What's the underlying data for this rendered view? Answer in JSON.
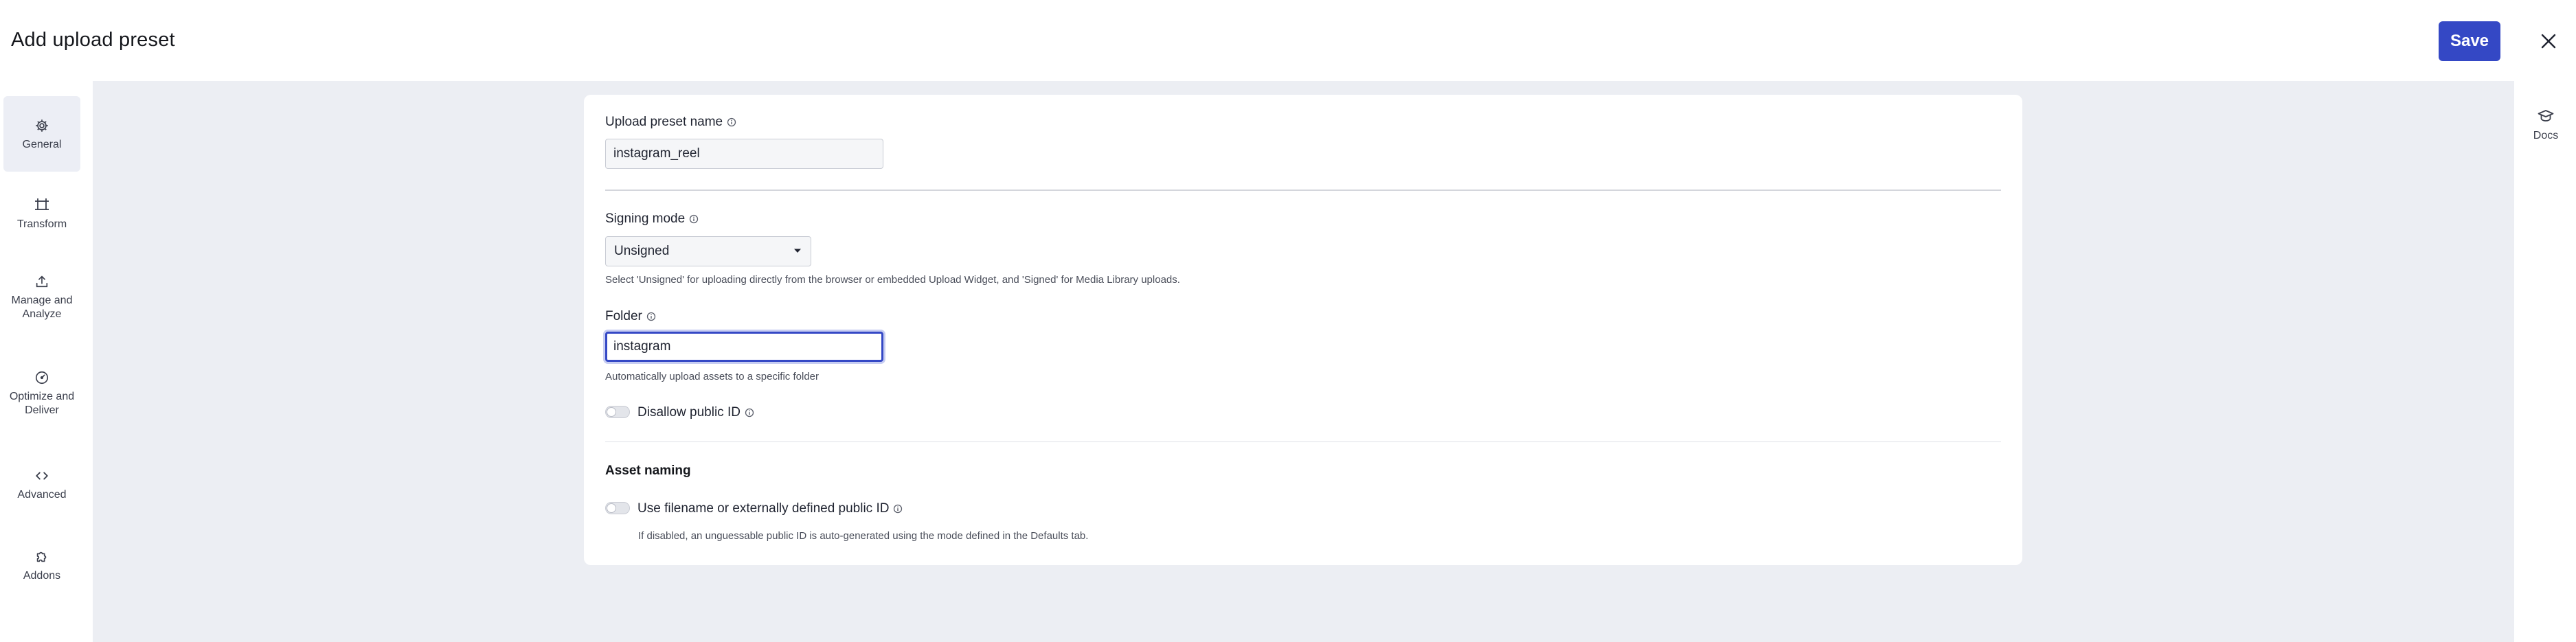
{
  "header": {
    "title": "Add upload preset",
    "save_label": "Save",
    "close_icon": "close-icon"
  },
  "sidebar": {
    "items": [
      {
        "label": "General",
        "icon": "gear-icon",
        "active": true
      },
      {
        "label": "Transform",
        "icon": "crop-icon",
        "active": false
      },
      {
        "label": "Manage and Analyze",
        "icon": "upload-icon",
        "active": false
      },
      {
        "label": "Optimize and Deliver",
        "icon": "speedometer-icon",
        "active": false
      },
      {
        "label": "Advanced",
        "icon": "code-icon",
        "active": false
      },
      {
        "label": "Addons",
        "icon": "puzzle-icon",
        "active": false
      }
    ]
  },
  "right_rail": {
    "docs_label": "Docs",
    "docs_icon": "graduation-cap-icon"
  },
  "form": {
    "preset_name": {
      "label": "Upload preset name",
      "value": "instagram_reel"
    },
    "signing_mode": {
      "label": "Signing mode",
      "selected": "Unsigned",
      "hint": "Select 'Unsigned' for uploading directly from the browser or embedded Upload Widget, and 'Signed' for Media Library uploads."
    },
    "folder": {
      "label": "Folder",
      "value": "instagram",
      "hint": "Automatically upload assets to a specific folder"
    },
    "disallow_public_id": {
      "label": "Disallow public ID",
      "enabled": false
    },
    "asset_naming": {
      "title": "Asset naming",
      "use_filename": {
        "label": "Use filename or externally defined public ID",
        "enabled": false,
        "hint": "If disabled, an unguessable public ID is auto-generated using the mode defined in the Defaults tab."
      }
    }
  },
  "colors": {
    "primary": "#3448c5",
    "background": "#eceef3",
    "active_nav": "#eceef5"
  }
}
